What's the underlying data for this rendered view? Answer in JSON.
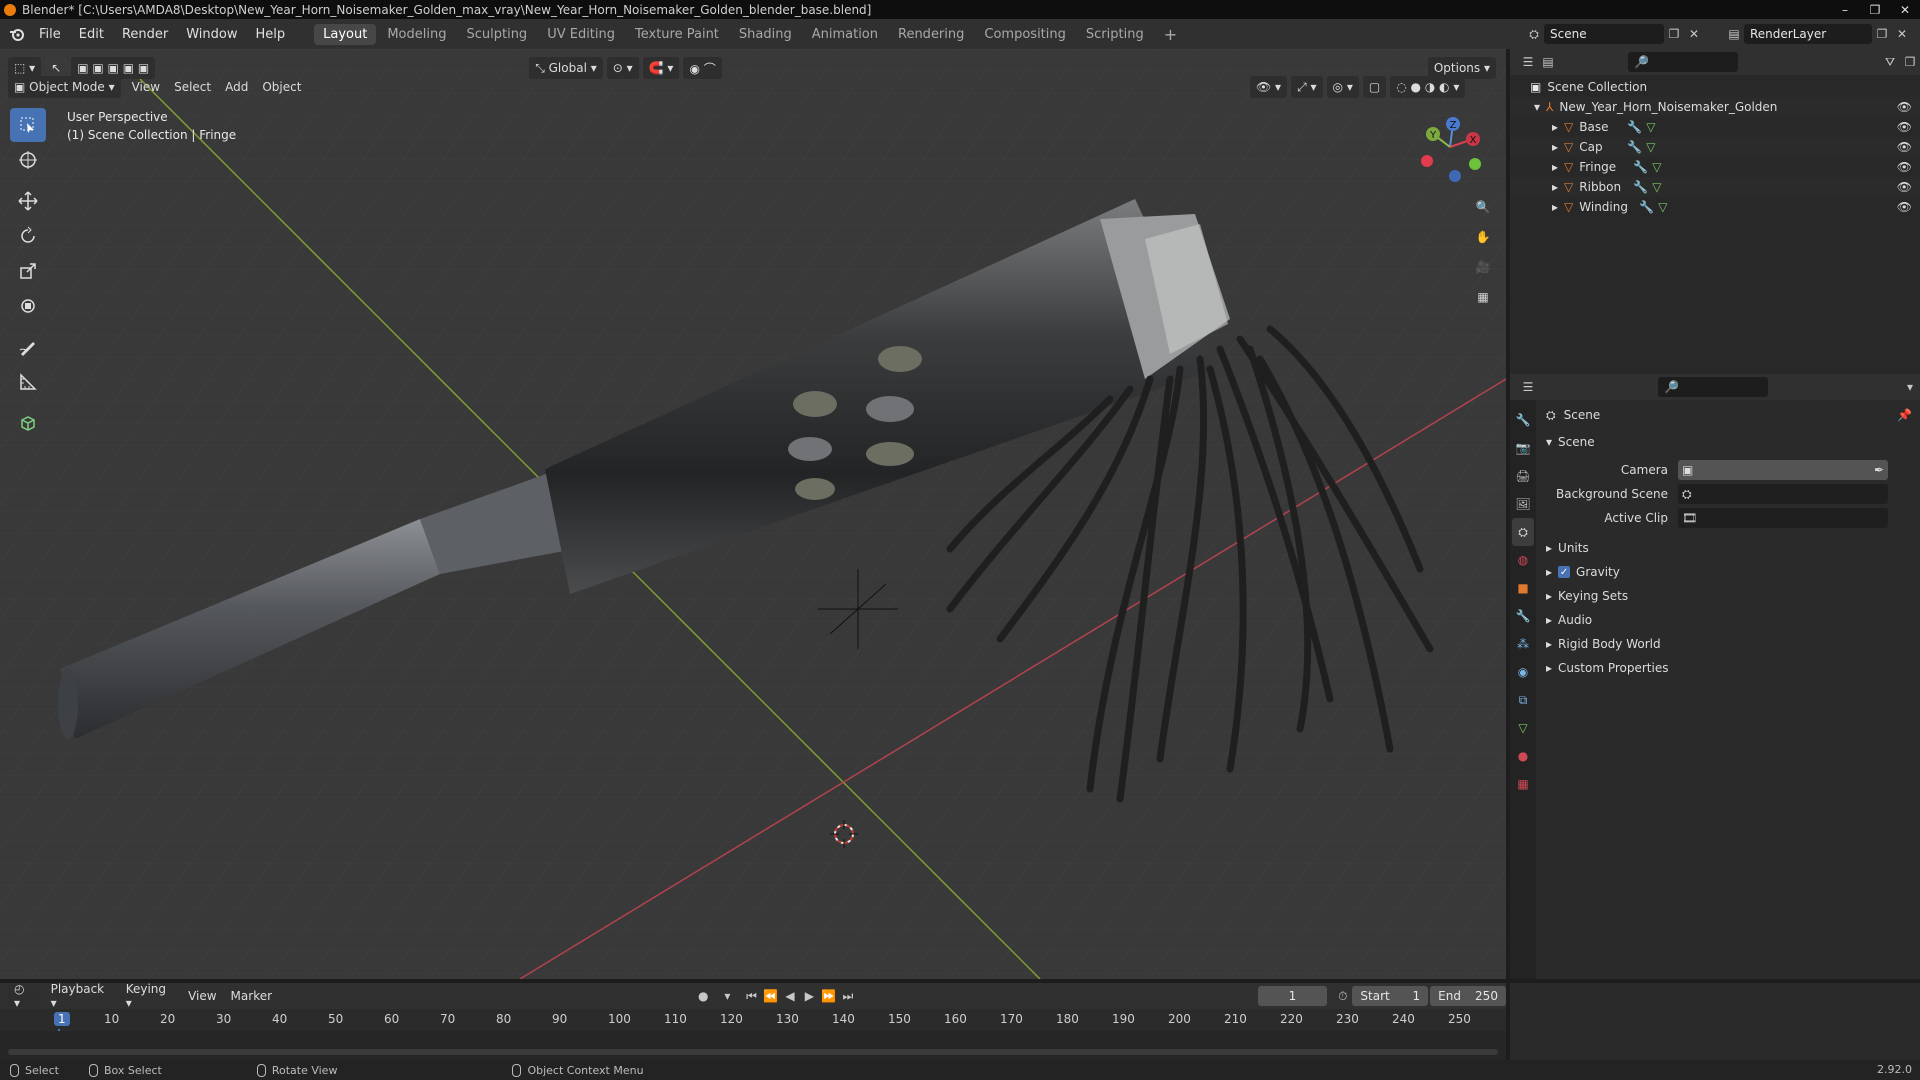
{
  "window": {
    "title": "Blender* [C:\\Users\\AMDA8\\Desktop\\New_Year_Horn_Noisemaker_Golden_max_vray\\New_Year_Horn_Noisemaker_Golden_blender_base.blend]",
    "controls": [
      "–",
      "❐",
      "✕"
    ]
  },
  "menubar": {
    "menus": [
      "File",
      "Edit",
      "Render",
      "Window",
      "Help"
    ],
    "workspaces": [
      "Layout",
      "Modeling",
      "Sculpting",
      "UV Editing",
      "Texture Paint",
      "Shading",
      "Animation",
      "Rendering",
      "Compositing",
      "Scripting"
    ],
    "active_workspace": "Layout",
    "add_tab": "+",
    "scene_name": "Scene",
    "view_layer": "RenderLayer"
  },
  "viewport": {
    "mode": "Object Mode",
    "menus": [
      "View",
      "Select",
      "Add",
      "Object"
    ],
    "orientation": "Global",
    "options": "Options",
    "perspective": "User Perspective",
    "collection_info": "(1) Scene Collection | Fringe"
  },
  "outliner": {
    "root": "Scene Collection",
    "collection": "New_Year_Horn_Noisemaker_Golden",
    "objects": [
      "Base",
      "Cap",
      "Fringe",
      "Ribbon",
      "Winding"
    ]
  },
  "properties": {
    "context": "Scene",
    "panel_title": "Scene",
    "fields": [
      {
        "label": "Camera",
        "value": ""
      },
      {
        "label": "Background Scene",
        "value": ""
      },
      {
        "label": "Active Clip",
        "value": ""
      }
    ],
    "sections": [
      "Units",
      "Gravity",
      "Keying Sets",
      "Audio",
      "Rigid Body World",
      "Custom Properties"
    ],
    "gravity_checked": true
  },
  "timeline": {
    "menus": [
      "Playback",
      "Keying",
      "View",
      "Marker"
    ],
    "current_frame": "1",
    "start_label": "Start",
    "start": "1",
    "end_label": "End",
    "end": "250",
    "ruler": [
      "1",
      "10",
      "20",
      "30",
      "40",
      "50",
      "60",
      "70",
      "80",
      "90",
      "100",
      "110",
      "120",
      "130",
      "140",
      "150",
      "160",
      "170",
      "180",
      "190",
      "200",
      "210",
      "220",
      "230",
      "240",
      "250"
    ]
  },
  "statusbar": {
    "items": [
      "Select",
      "Box Select",
      "Rotate View",
      "Object Context Menu"
    ],
    "version": "2.92.0"
  },
  "colors": {
    "accent": "#4772b3",
    "orange": "#e87d0d",
    "axis_x": "#b3424f",
    "axis_y": "#7da031",
    "viewport_bg": "#393939"
  }
}
